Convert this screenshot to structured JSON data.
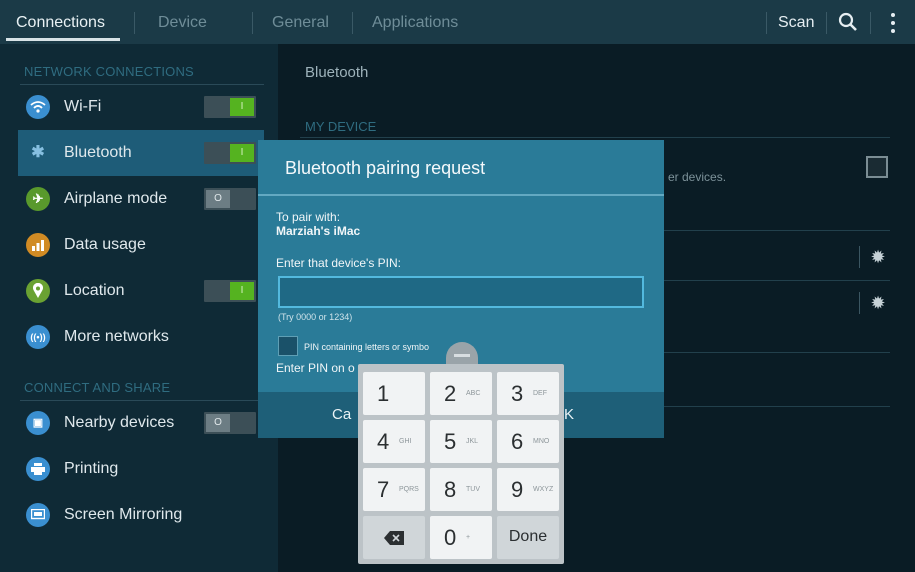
{
  "tabs": [
    "Connections",
    "Device",
    "General",
    "Applications"
  ],
  "actions": {
    "scan": "Scan",
    "search_icon": "search-icon",
    "more_icon": "more-vert-icon"
  },
  "sidebar": {
    "network_header": "NETWORK CONNECTIONS",
    "connect_header": "CONNECT AND SHARE",
    "items": [
      {
        "label": "Wi-Fi",
        "icon": "wifi-icon",
        "color": "#3a8fd0"
      },
      {
        "label": "Bluetooth",
        "icon": "bluetooth-icon",
        "color": "#86bfe0"
      },
      {
        "label": "Airplane mode",
        "icon": "airplane-icon",
        "color": "#59992c"
      },
      {
        "label": "Data usage",
        "icon": "data-usage-icon",
        "color": "#d18b24"
      },
      {
        "label": "Location",
        "icon": "location-icon",
        "color": "#6aa232"
      },
      {
        "label": "More networks",
        "icon": "more-networks-icon",
        "color": "#3a8fd0"
      },
      {
        "label": "Nearby devices",
        "icon": "nearby-devices-icon",
        "color": "#3a8fd0"
      },
      {
        "label": "Printing",
        "icon": "printer-icon",
        "color": "#3a8fd0"
      },
      {
        "label": "Screen Mirroring",
        "icon": "screen-mirroring-icon",
        "color": "#3a8fd0"
      }
    ],
    "toggles": {
      "wifi": true,
      "bluetooth": true,
      "airplane": false,
      "location": true,
      "nearby": false
    }
  },
  "main": {
    "title": "Bluetooth",
    "my_device": "MY DEVICE",
    "device_text": "er devices."
  },
  "dialog": {
    "title": "Bluetooth pairing request",
    "pair_with_label": "To pair with:",
    "device_name": "Marziah's iMac",
    "pin_prompt": "Enter that device's PIN:",
    "pin_value": "",
    "hint": "(Try 0000 or 1234)",
    "checkbox_label": "PIN containing letters or symbo",
    "enter_pin_other": "Enter PIN on o",
    "cancel": "Ca",
    "ok_fragment": "K"
  },
  "keypad": {
    "keys": [
      {
        "n": "1",
        "s": ""
      },
      {
        "n": "2",
        "s": "ABC"
      },
      {
        "n": "3",
        "s": "DEF"
      },
      {
        "n": "4",
        "s": "GHI"
      },
      {
        "n": "5",
        "s": "JKL"
      },
      {
        "n": "6",
        "s": "MNO"
      },
      {
        "n": "7",
        "s": "PQRS"
      },
      {
        "n": "8",
        "s": "TUV"
      },
      {
        "n": "9",
        "s": "WXYZ"
      }
    ],
    "zero": "0",
    "zero_sub": "+",
    "done": "Done",
    "backspace_icon": "backspace-icon"
  }
}
